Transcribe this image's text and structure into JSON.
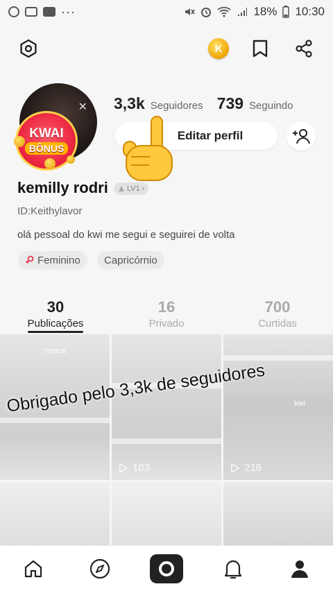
{
  "status_bar": {
    "battery": "18%",
    "time": "10:30",
    "more": "···"
  },
  "avatar_badge": {
    "line1": "KWAI",
    "line2": "BÔNUS"
  },
  "coin": {
    "letter": "K"
  },
  "stats": {
    "followers_count": "3,3k",
    "followers_label": "Seguidores",
    "following_count": "739",
    "following_label": "Seguindo"
  },
  "buttons": {
    "edit_profile": "Editar perfil",
    "add_friend": "+"
  },
  "profile": {
    "name": "kemilly rodri",
    "level": "LV1",
    "id": "ID:Keithylavor",
    "bio": "olá pessoal do kwi me segui e seguirei de volta",
    "tags": [
      "Feminino",
      "Capricórnio"
    ]
  },
  "tabs": [
    {
      "count": "30",
      "label": "Publicações"
    },
    {
      "count": "16",
      "label": "Privado"
    },
    {
      "count": "700",
      "label": "Curtidas"
    }
  ],
  "grid": {
    "cell1_caption": "nunca",
    "cell2_views": "103",
    "cell3_views": "218",
    "cell3_mark": "kwi"
  },
  "overlay_text": "Obrigado pelo 3,3k de seguidores",
  "icons": {
    "settings": "hexagon-settings-icon",
    "coin": "kwai-coin-icon",
    "bookmark": "bookmark-icon",
    "share": "share-icon",
    "add_friend": "add-person-icon",
    "home": "home-icon",
    "discover": "compass-icon",
    "camera": "camera-icon",
    "notifications": "bell-icon",
    "profile": "person-icon"
  },
  "colors": {
    "badge_red": "#e8213c",
    "coin_gold": "#f0a400",
    "text_dark": "#222222"
  }
}
